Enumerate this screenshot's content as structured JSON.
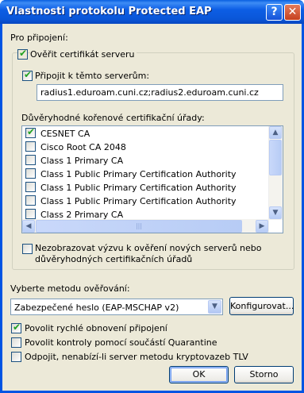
{
  "window": {
    "title": "Vlastnosti protokolu Protected EAP",
    "help_glyph": "?",
    "close_glyph": "✕"
  },
  "connection": {
    "group_label": "Pro připojení:",
    "validate_cert": {
      "label": "Ověřit certifikát serveru",
      "checked": true
    },
    "connect_to_servers": {
      "label": "Připojit k těmto serverům:",
      "checked": true
    },
    "servers_value": "radius1.eduroam.cuni.cz;radius2.eduroam.cuni.cz",
    "trusted_ca_label": "Důvěryhodné kořenové certifikační úřady:",
    "ca_list": [
      {
        "label": "CESNET CA",
        "checked": true
      },
      {
        "label": "Cisco Root CA 2048",
        "checked": false
      },
      {
        "label": "Class 1 Primary CA",
        "checked": false
      },
      {
        "label": "Class 1 Public Primary Certification Authority",
        "checked": false
      },
      {
        "label": "Class 1 Public Primary Certification Authority",
        "checked": false
      },
      {
        "label": "Class 1 Public Primary Certification Authority",
        "checked": false
      },
      {
        "label": "Class 2 Primary CA",
        "checked": false
      }
    ],
    "no_prompt": {
      "label_line1": "Nezobrazovat výzvu k ověření nových serverů nebo",
      "label_line2": "důvěryhodných certifikačních úřadů",
      "checked": false
    }
  },
  "auth_method": {
    "label": "Vyberte metodu ověřování:",
    "selected": "Zabezpečené heslo (EAP-MSCHAP v2)",
    "configure_button": "Konfigurovat..."
  },
  "options": [
    {
      "label": "Povolit rychlé obnovení připojení",
      "checked": true
    },
    {
      "label": "Povolit kontroly pomocí součástí Quarantine",
      "checked": false
    },
    {
      "label": "Odpojit, nenabízí-li server metodu kryptovazeb TLV",
      "checked": false
    }
  ],
  "buttons": {
    "ok": "OK",
    "cancel": "Storno"
  },
  "checkmark_glyph": "✔",
  "scroll_glyphs": {
    "up": "▲",
    "down": "▼",
    "left": "◀",
    "right": "▶",
    "dropdown": "▼",
    "grip": "|||"
  }
}
